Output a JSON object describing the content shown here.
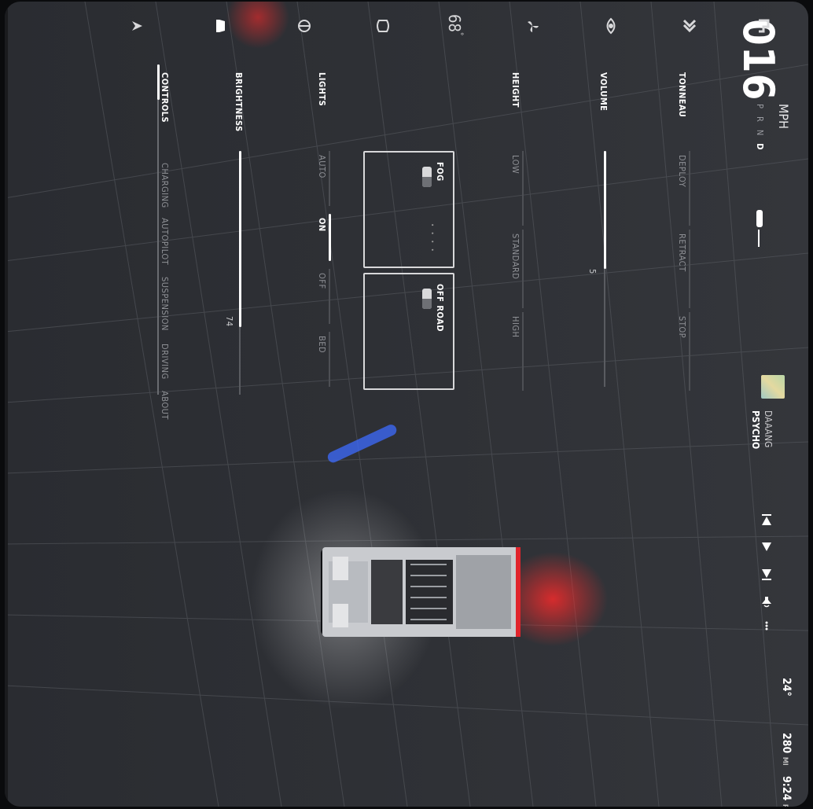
{
  "status": {
    "time": "9:24",
    "ampm": "PM",
    "range": "280",
    "range_unit": "MI",
    "temp_outside": "24"
  },
  "speed": {
    "value": "016",
    "unit": "MPH",
    "gears": [
      "P",
      "R",
      "N",
      "D"
    ],
    "selected_gear": "D"
  },
  "tabs": [
    "CONTROLS",
    "CHARGING",
    "AUTOPILOT",
    "SUSPENSION",
    "DRIVING",
    "ABOUT"
  ],
  "active_tab": "CONTROLS",
  "brightness": {
    "label": "BRIGHTNESS",
    "value": "74",
    "level_percent": 74
  },
  "lights": {
    "label": "LIGHTS",
    "options": [
      "AUTO",
      "ON",
      "OFF",
      "BED"
    ],
    "selected": "ON"
  },
  "fog": {
    "label": "FOG"
  },
  "offroad": {
    "label": "OFF ROAD"
  },
  "height": {
    "label": "HEIGHT",
    "options": [
      "LOW",
      "STANDARD",
      "HIGH"
    ]
  },
  "volume": {
    "label": "VOLUME",
    "value": "5",
    "level_percent": 50
  },
  "tonneau": {
    "label": "TONNEAU",
    "options": [
      "DEPLOY",
      "RETRACT",
      "STOP"
    ]
  },
  "cabin_temp": "68",
  "media": {
    "title": "PSYCHO",
    "artist": "DAAANG"
  },
  "colors": {
    "accent_red": "#e0242c",
    "accent_blue": "#3d6bff",
    "background": "#2d2f34",
    "text": "#ffffff"
  },
  "sidebar_icons": [
    "navigate-icon",
    "car-icon",
    "headlight-icon",
    "defrost-icon",
    "temperature",
    "fan-icon",
    "camera-icon",
    "seat-heat-icon",
    "apps-icon"
  ]
}
